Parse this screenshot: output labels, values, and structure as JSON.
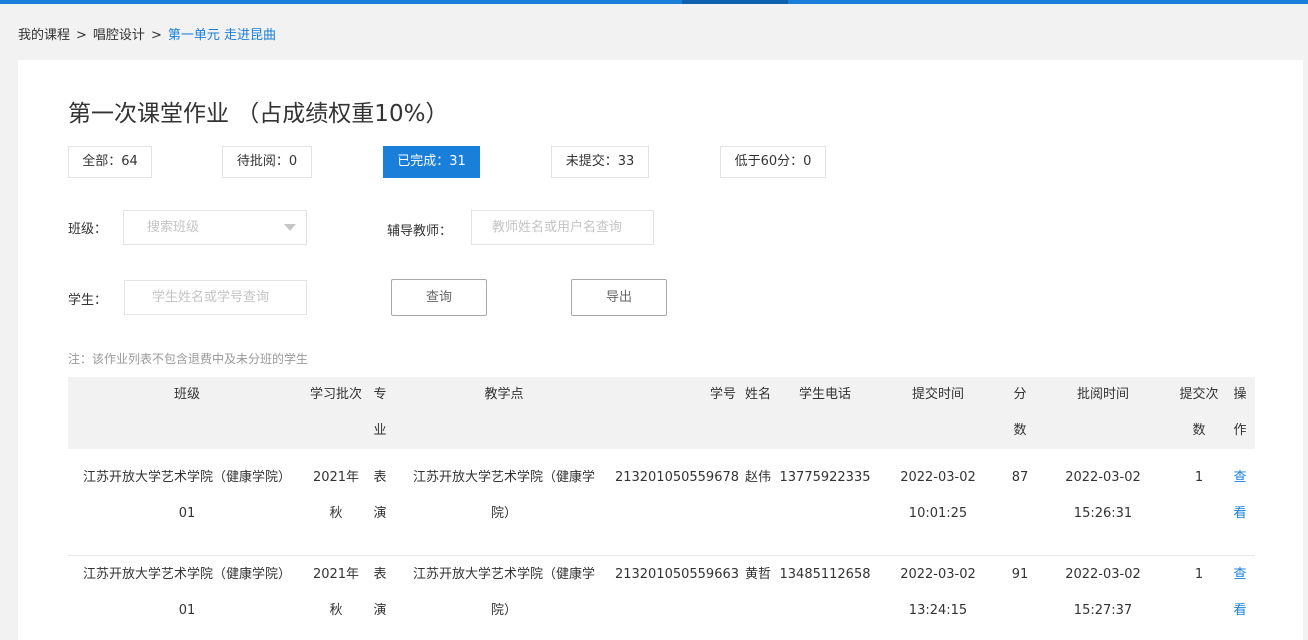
{
  "breadcrumb": {
    "items": [
      "我的课程",
      "唱腔设计",
      "第一单元 走进昆曲"
    ],
    "separator": ">"
  },
  "page": {
    "title": "第一次课堂作业 （占成绩权重10%）"
  },
  "status_tabs": [
    {
      "label": "全部：64",
      "active": false
    },
    {
      "label": "待批阅：0",
      "active": false
    },
    {
      "label": "已完成：31",
      "active": true
    },
    {
      "label": "未提交：33",
      "active": false
    },
    {
      "label": "低于60分：0",
      "active": false
    }
  ],
  "filters": {
    "class_label": "班级：",
    "class_placeholder": "搜索班级",
    "teacher_label": "辅导教师：",
    "teacher_placeholder": "教师姓名或用户名查询",
    "student_label": "学生：",
    "student_placeholder": "学生姓名或学号查询",
    "query_button": "查询",
    "export_button": "导出"
  },
  "note": "注：该作业列表不包含退费中及未分班的学生",
  "table": {
    "headers": {
      "class": "班级",
      "batch": "学习批次",
      "major": [
        "专",
        "业"
      ],
      "site": "教学点",
      "student_id": "学号",
      "name": "姓名",
      "phone": "学生电话",
      "submit_time": "提交时间",
      "score": [
        "分",
        "数"
      ],
      "review_time": "批阅时间",
      "submit_count": [
        "提交次",
        "数"
      ],
      "action": [
        "操",
        "作"
      ]
    },
    "rows": [
      {
        "class": [
          "江苏开放大学艺术学院（健康学院）",
          "01"
        ],
        "batch": [
          "2021年",
          "秋"
        ],
        "major": [
          "表",
          "演"
        ],
        "site": [
          "江苏开放大学艺术学院（健康学",
          "院）"
        ],
        "student_id": "213201050559678",
        "name": "赵伟",
        "phone": "13775922335",
        "submit_time": [
          "2022-03-02",
          "10:01:25"
        ],
        "score": "87",
        "review_time": [
          "2022-03-02",
          "15:26:31"
        ],
        "submit_count": "1",
        "action": [
          "查",
          "看"
        ]
      },
      {
        "class": [
          "江苏开放大学艺术学院（健康学院）",
          "01"
        ],
        "batch": [
          "2021年",
          "秋"
        ],
        "major": [
          "表",
          "演"
        ],
        "site": [
          "江苏开放大学艺术学院（健康学",
          "院）"
        ],
        "student_id": "213201050559663",
        "name": "黄哲",
        "phone": "13485112658",
        "submit_time": [
          "2022-03-02",
          "13:24:15"
        ],
        "score": "91",
        "review_time": [
          "2022-03-02",
          "15:27:37"
        ],
        "submit_count": "1",
        "action": [
          "查",
          "看"
        ]
      }
    ]
  },
  "colors": {
    "accent": "#1a7fd9",
    "page_bg": "#f2f2f2",
    "header_bg": "#f2f2f2"
  }
}
